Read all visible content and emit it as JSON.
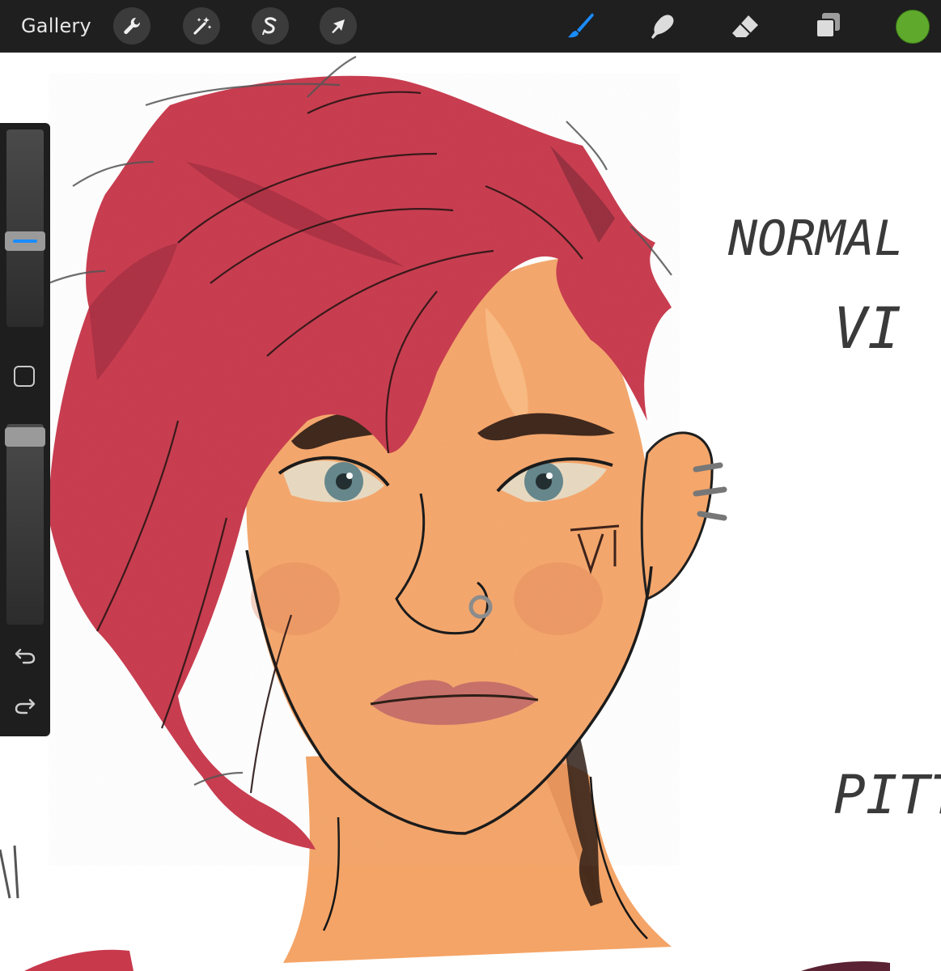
{
  "toolbar": {
    "gallery_label": "Gallery",
    "left_tools": [
      {
        "name": "wrench-icon"
      },
      {
        "name": "magic-wand-icon"
      },
      {
        "name": "selection-s-icon"
      },
      {
        "name": "transform-arrow-icon"
      }
    ],
    "right_tools": [
      {
        "name": "brush-icon",
        "active": true
      },
      {
        "name": "smudge-icon"
      },
      {
        "name": "eraser-icon"
      },
      {
        "name": "layers-icon"
      }
    ],
    "current_color": "#5faa2c",
    "active_tool_color": "#1a8cff"
  },
  "canvas": {
    "handwritten_notes": [
      "NORMAL",
      "VI",
      "PITT"
    ]
  },
  "sidebar": {
    "controls": [
      "brush-size-slider",
      "modify-button",
      "opacity-slider",
      "undo-icon",
      "redo-icon"
    ]
  }
}
